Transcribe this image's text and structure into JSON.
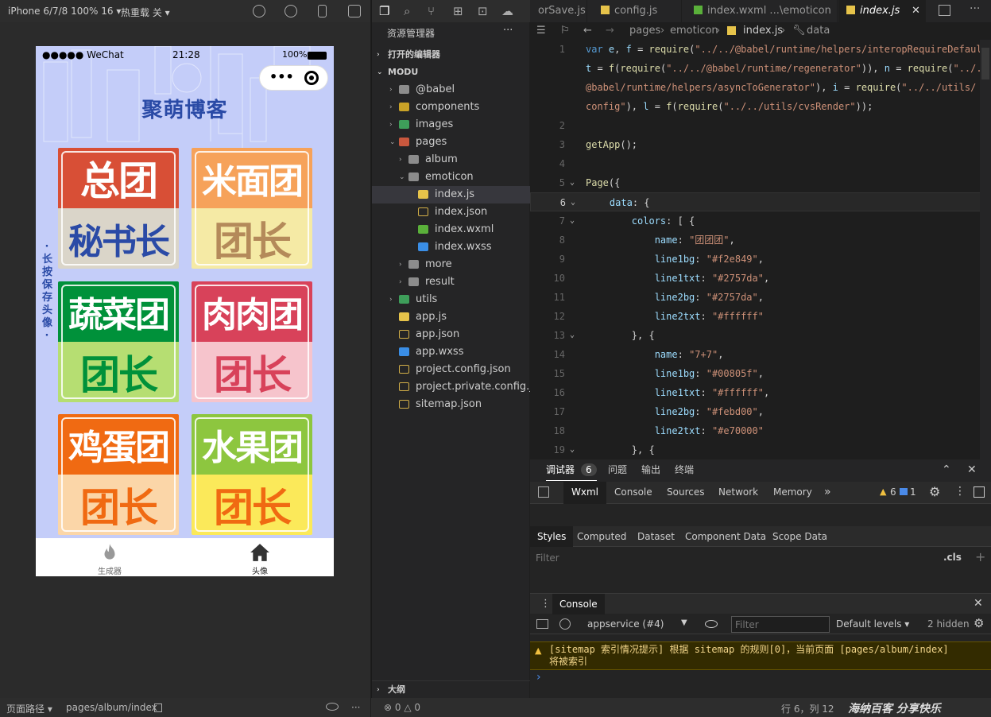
{
  "simulator": {
    "device": "iPhone 6/7/8 100% 16 ▾",
    "hot_reload": "热重载 关 ▾",
    "status_carrier": "●●●●● WeChat",
    "status_time": "21:28",
    "status_battery": "100%",
    "capsule_dots": "•••",
    "page_title": "聚萌博客",
    "vertical_hint": "·长按保存头像·",
    "cards": [
      {
        "line1": "总团",
        "line2": "秘书长"
      },
      {
        "line1": "米面团",
        "line2": "团长"
      },
      {
        "line1": "蔬菜团",
        "line2": "团长"
      },
      {
        "line1": "肉肉团",
        "line2": "团长"
      },
      {
        "line1": "鸡蛋团",
        "line2": "团长"
      },
      {
        "line1": "水果团",
        "line2": "团长"
      }
    ],
    "tabs": [
      {
        "label": "生成器"
      },
      {
        "label": "头像"
      }
    ],
    "footer_path_label": "页面路径 ▾",
    "footer_path": "pages/album/index"
  },
  "colors": {
    "card1_l1bg": "#d84f36",
    "card1_l1txt": "#ffffff",
    "card1_l2bg": "#dad5c9",
    "card1_l2txt": "#2a4aa6",
    "card2_l1bg": "#f6a25a",
    "card2_l1txt": "#ffffff",
    "card2_l2bg": "#f5eaa5",
    "card2_l2txt": "#b48a5a",
    "card3_l1bg": "#00913a",
    "card3_l1txt": "#ffffff",
    "card3_l2bg": "#b6de72",
    "card3_l2txt": "#00913a",
    "card4_l1bg": "#d8425a",
    "card4_l1txt": "#ffffff",
    "card4_l2bg": "#f6c4cc",
    "card4_l2txt": "#d8425a",
    "card5_l1bg": "#f06a12",
    "card5_l1txt": "#ffffff",
    "card5_l2bg": "#fbd6a8",
    "card5_l2txt": "#f06a12",
    "card6_l1bg": "#8dc63f",
    "card6_l1txt": "#ffffff",
    "card6_l2bg": "#fbe95a",
    "card6_l2txt": "#f06a12"
  },
  "explorer": {
    "title": "资源管理器",
    "more": "···",
    "open_editors": "打开的编辑器",
    "project": "MODU",
    "tree": [
      {
        "label": "@babel",
        "depth": 1,
        "arrow": "›",
        "type": "folder"
      },
      {
        "label": "components",
        "depth": 1,
        "arrow": "›",
        "type": "folder-y"
      },
      {
        "label": "images",
        "depth": 1,
        "arrow": "›",
        "type": "folder-g"
      },
      {
        "label": "pages",
        "depth": 1,
        "arrow": "⌄",
        "type": "folder-r"
      },
      {
        "label": "album",
        "depth": 2,
        "arrow": "›",
        "type": "folder"
      },
      {
        "label": "emoticon",
        "depth": 2,
        "arrow": "⌄",
        "type": "folder"
      },
      {
        "label": "index.js",
        "depth": 3,
        "arrow": "",
        "type": "js",
        "selected": true
      },
      {
        "label": "index.json",
        "depth": 3,
        "arrow": "",
        "type": "json"
      },
      {
        "label": "index.wxml",
        "depth": 3,
        "arrow": "",
        "type": "wxml"
      },
      {
        "label": "index.wxss",
        "depth": 3,
        "arrow": "",
        "type": "wxss"
      },
      {
        "label": "more",
        "depth": 2,
        "arrow": "›",
        "type": "folder"
      },
      {
        "label": "result",
        "depth": 2,
        "arrow": "›",
        "type": "folder"
      },
      {
        "label": "utils",
        "depth": 1,
        "arrow": "›",
        "type": "folder-g"
      },
      {
        "label": "app.js",
        "depth": 1,
        "arrow": "",
        "type": "js"
      },
      {
        "label": "app.json",
        "depth": 1,
        "arrow": "",
        "type": "json"
      },
      {
        "label": "app.wxss",
        "depth": 1,
        "arrow": "",
        "type": "wxss"
      },
      {
        "label": "project.config.json",
        "depth": 1,
        "arrow": "",
        "type": "json"
      },
      {
        "label": "project.private.config.js...",
        "depth": 1,
        "arrow": "",
        "type": "json"
      },
      {
        "label": "sitemap.json",
        "depth": 1,
        "arrow": "",
        "type": "json"
      }
    ],
    "outline": "大纲"
  },
  "editor": {
    "tabs": [
      {
        "label": "orSave.js"
      },
      {
        "label": "config.js"
      },
      {
        "label": "index.wxml  ...\\emoticon"
      },
      {
        "label": "index.js"
      }
    ],
    "close": "✕",
    "breadcrumb": [
      "pages",
      "emoticon",
      "index.js",
      "data"
    ],
    "lines": [
      {
        "n": "1",
        "html": "<span class='kw'>var</span> <span class='v'>e</span>, <span class='v'>f</span> = <span class='f'>require</span>(<span class='s'>\"../../@babel/runtime/helpers/interopRequireDefault\"</span>),"
      },
      {
        "n": "",
        "html": "<span class='v'>t</span> = <span class='f'>f</span>(<span class='f'>require</span>(<span class='s'>\"../../@babel/runtime/regenerator\"</span>)), <span class='v'>n</span> = <span class='f'>require</span>(<span class='s'>\"../../</span>"
      },
      {
        "n": "",
        "html": "<span class='s'>@babel/runtime/helpers/asyncToGenerator\"</span>), <span class='v'>i</span> = <span class='f'>require</span>(<span class='s'>\"../../utils/</span>"
      },
      {
        "n": "",
        "html": "<span class='s'>config\"</span>), <span class='v'>l</span> = <span class='f'>f</span>(<span class='f'>require</span>(<span class='s'>\"../../utils/cvsRender\"</span>));"
      },
      {
        "n": "2",
        "html": ""
      },
      {
        "n": "3",
        "html": "<span class='f'>getApp</span>();"
      },
      {
        "n": "4",
        "html": ""
      },
      {
        "n": "5",
        "html": "<span class='f'>Page</span>({"
      },
      {
        "n": "6",
        "html": "    <span class='v'>data</span>: {"
      },
      {
        "n": "7",
        "html": "        <span class='v'>colors</span>: [ {"
      },
      {
        "n": "8",
        "html": "            <span class='v'>name</span>: <span class='s'>\"团团团\"</span>,"
      },
      {
        "n": "9",
        "html": "            <span class='v'>line1bg</span>: <span class='s'>\"#f2e849\"</span>,"
      },
      {
        "n": "10",
        "html": "            <span class='v'>line1txt</span>: <span class='s'>\"#2757da\"</span>,"
      },
      {
        "n": "11",
        "html": "            <span class='v'>line2bg</span>: <span class='s'>\"#2757da\"</span>,"
      },
      {
        "n": "12",
        "html": "            <span class='v'>line2txt</span>: <span class='s'>\"#ffffff\"</span>"
      },
      {
        "n": "13",
        "html": "        }, {"
      },
      {
        "n": "14",
        "html": "            <span class='v'>name</span>: <span class='s'>\"7+7\"</span>,"
      },
      {
        "n": "15",
        "html": "            <span class='v'>line1bg</span>: <span class='s'>\"#00805f\"</span>,"
      },
      {
        "n": "16",
        "html": "            <span class='v'>line1txt</span>: <span class='s'>\"#ffffff\"</span>,"
      },
      {
        "n": "17",
        "html": "            <span class='v'>line2bg</span>: <span class='s'>\"#febd00\"</span>,"
      },
      {
        "n": "18",
        "html": "            <span class='v'>line2txt</span>: <span class='s'>\"#e70000\"</span>"
      },
      {
        "n": "19",
        "html": "        }, {"
      }
    ]
  },
  "devtools": {
    "panel_tabs": [
      {
        "label": "调试器"
      },
      {
        "label": "问题"
      },
      {
        "label": "输出"
      },
      {
        "label": "终端"
      }
    ],
    "debugger_count": "6",
    "tool_tabs": [
      {
        "label": "Wxml"
      },
      {
        "label": "Console"
      },
      {
        "label": "Sources"
      },
      {
        "label": "Network"
      },
      {
        "label": "Memory"
      }
    ],
    "more_tabs": "»",
    "warn_count": "6",
    "info_count": "1",
    "style_tabs": [
      {
        "label": "Styles"
      },
      {
        "label": "Computed"
      },
      {
        "label": "Dataset"
      },
      {
        "label": "Component Data"
      },
      {
        "label": "Scope Data"
      }
    ],
    "filter_placeholder": "Filter",
    "cls": ".cls",
    "plus": "+",
    "console_title": "Console",
    "context": "appservice (#4)",
    "console_filter_placeholder": "Filter",
    "levels": "Default levels ▾",
    "hidden": "2 hidden",
    "warning": "[sitemap 索引情况提示] 根据 sitemap 的规则[0]，当前页面 [pages/album/index] 将被索引",
    "prompt": "›"
  },
  "statusbar": {
    "errors": "⊗ 0 △ 0",
    "position": "行 6，列 12",
    "brand": "海纳百客 分享快乐"
  }
}
